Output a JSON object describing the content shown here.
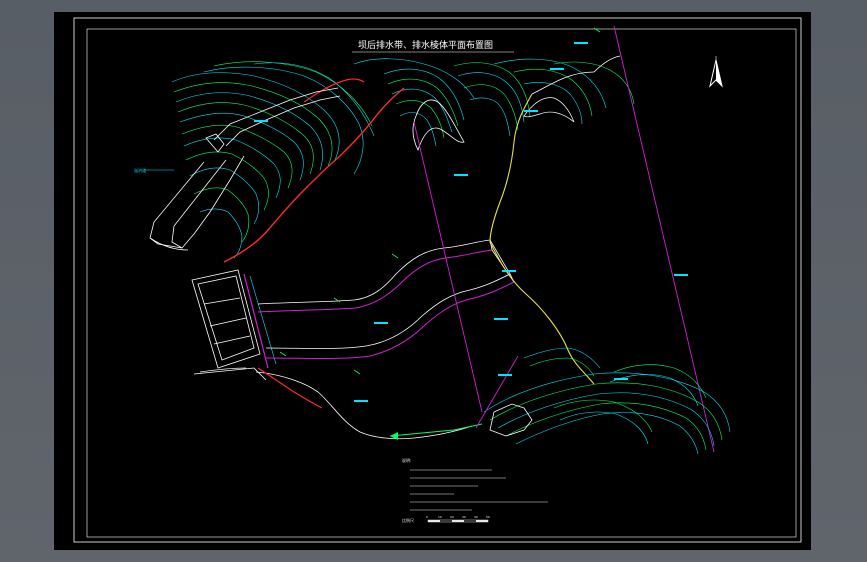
{
  "drawing": {
    "title": "坝后排水带、排水棱体平面布置图",
    "notes_heading": "说明:",
    "scale_label": "比例尺",
    "scale_ticks": [
      "0",
      "10",
      "20",
      "30",
      "40",
      "50"
    ]
  },
  "colors": {
    "background": "#000000",
    "frame": "#ffffff",
    "contour_cyan": "#00e5ff",
    "contour_green": "#00ff66",
    "dam_red": "#ff2a2a",
    "alignment_magenta": "#d020d0",
    "road_yellow": "#e8e040",
    "drain_white": "#ffffff"
  },
  "icons": {
    "north_arrow": "north-arrow-icon"
  }
}
